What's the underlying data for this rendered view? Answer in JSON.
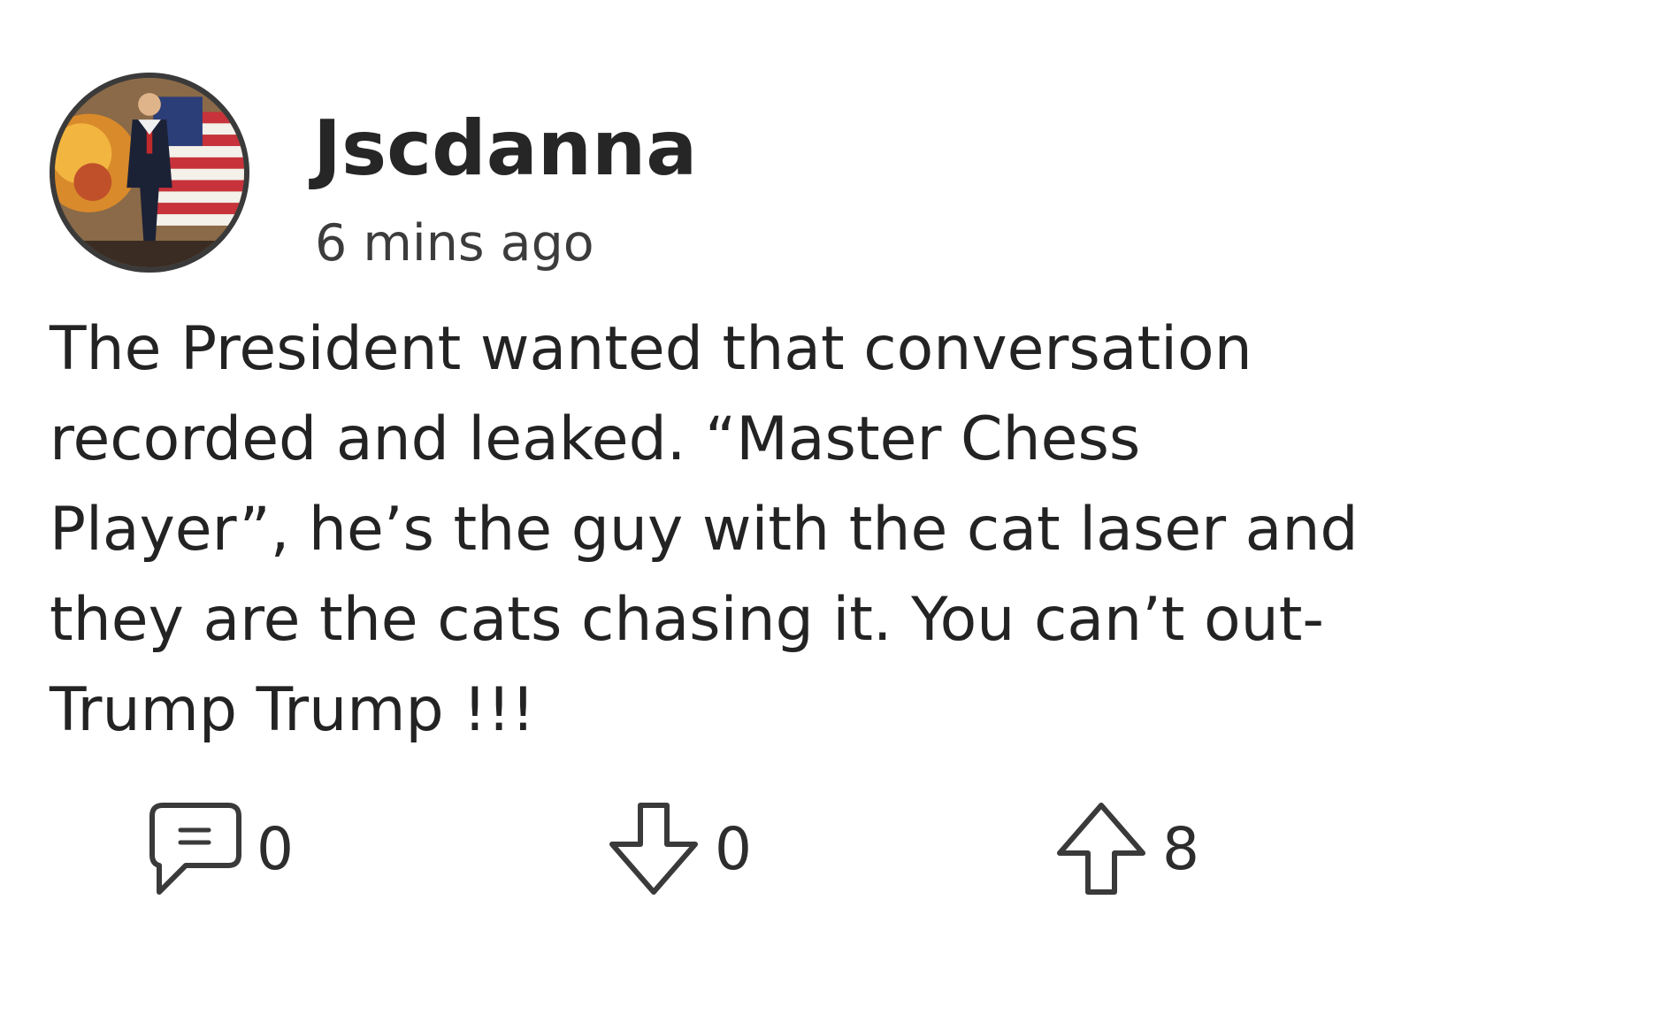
{
  "post": {
    "username": "Jscdanna",
    "timestamp": "6 mins ago",
    "body_lines": [
      "The President wanted that conversation",
      "recorded and leaked. “Master Chess",
      "Player”, he’s the guy with the cat laser and",
      "they are the cats chasing it. You can’t out-",
      "Trump Trump !!!"
    ]
  },
  "actions": {
    "comment_count": "0",
    "downvote_count": "0",
    "upvote_count": "8"
  },
  "icons": {
    "avatar": "user-avatar-image",
    "comment": "comment-bubble-icon",
    "downvote": "arrow-down-icon",
    "upvote": "arrow-up-icon"
  },
  "colors": {
    "background": "#ffffff",
    "text": "#232323",
    "avatar_border": "#3a3a3a"
  }
}
